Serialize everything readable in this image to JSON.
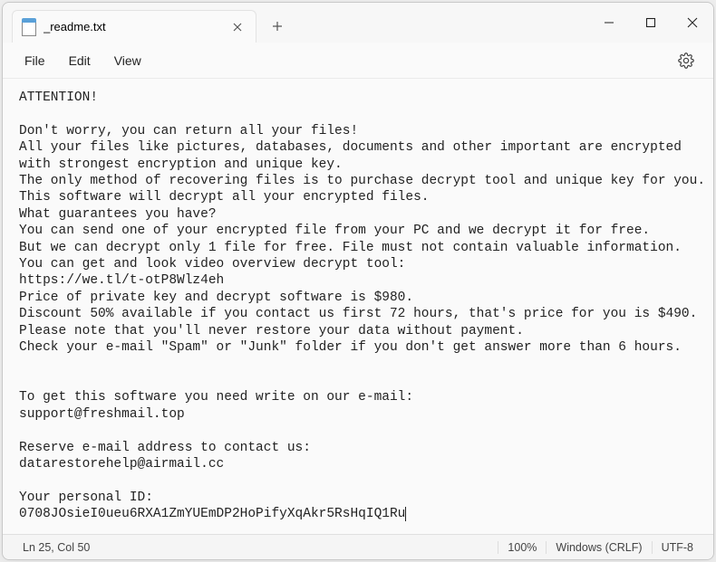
{
  "tab": {
    "title": "_readme.txt"
  },
  "menu": {
    "file": "File",
    "edit": "Edit",
    "view": "View"
  },
  "body": {
    "lines": [
      "ATTENTION!",
      "",
      "Don't worry, you can return all your files!",
      "All your files like pictures, databases, documents and other important are encrypted",
      "with strongest encryption and unique key.",
      "The only method of recovering files is to purchase decrypt tool and unique key for you.",
      "This software will decrypt all your encrypted files.",
      "What guarantees you have?",
      "You can send one of your encrypted file from your PC and we decrypt it for free.",
      "But we can decrypt only 1 file for free. File must not contain valuable information.",
      "You can get and look video overview decrypt tool:",
      "https://we.tl/t-otP8Wlz4eh",
      "Price of private key and decrypt software is $980.",
      "Discount 50% available if you contact us first 72 hours, that's price for you is $490.",
      "Please note that you'll never restore your data without payment.",
      "Check your e-mail \"Spam\" or \"Junk\" folder if you don't get answer more than 6 hours.",
      "",
      "",
      "To get this software you need write on our e-mail:",
      "support@freshmail.top",
      "",
      "Reserve e-mail address to contact us:",
      "datarestorehelp@airmail.cc",
      "",
      "Your personal ID:",
      "0708JOsieI0ueu6RXA1ZmYUEmDP2HoPifyXqAkr5RsHqIQ1Ru"
    ]
  },
  "status": {
    "position": "Ln 25, Col 50",
    "zoom": "100%",
    "linebreak": "Windows (CRLF)",
    "encoding": "UTF-8"
  }
}
